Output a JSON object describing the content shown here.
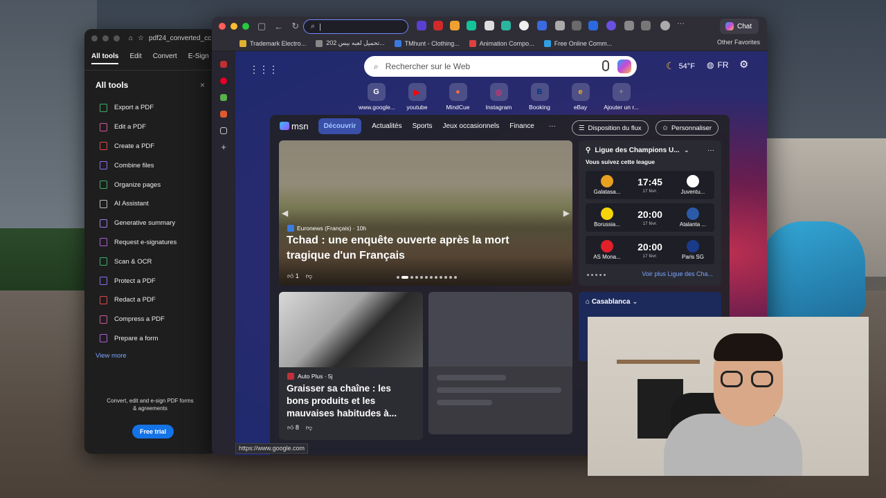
{
  "acrobat": {
    "tab_title": "pdf24_converted_cc",
    "menu": [
      "All tools",
      "Edit",
      "Convert",
      "E-Sign"
    ],
    "header": "All tools",
    "close": "×",
    "tools": [
      {
        "label": "Export a PDF",
        "color": "#3fb06b"
      },
      {
        "label": "Edit a PDF",
        "color": "#d35aa0"
      },
      {
        "label": "Create a PDF",
        "color": "#e0474c"
      },
      {
        "label": "Combine files",
        "color": "#8f6df0"
      },
      {
        "label": "Organize pages",
        "color": "#3fb06b"
      },
      {
        "label": "AI Assistant",
        "color": "#bbbbbb"
      },
      {
        "label": "Generative summary",
        "color": "#9f7df0"
      },
      {
        "label": "Request e-signatures",
        "color": "#b05fd6"
      },
      {
        "label": "Scan & OCR",
        "color": "#3fb06b"
      },
      {
        "label": "Protect a PDF",
        "color": "#8f6df0"
      },
      {
        "label": "Redact a PDF",
        "color": "#e0474c"
      },
      {
        "label": "Compress a PDF",
        "color": "#d35aa0"
      },
      {
        "label": "Prepare a form",
        "color": "#b05fd6"
      }
    ],
    "view_more": "View more",
    "footer_text": "Convert, edit and e-sign PDF forms & agreements",
    "free_trial": "Free trial"
  },
  "browser": {
    "chat_label": "Chat",
    "bookmarks": [
      "Trademark Electro...",
      "تحميل لعبه بيس 202...",
      "TMhunt - Clothing...",
      "Animation Compo...",
      "Free Online Comm..."
    ],
    "other_favorites": "Other Favorites",
    "status_url": "https://www.google.com"
  },
  "newtab": {
    "search_placeholder": "Rechercher sur le Web",
    "weather": "54°F",
    "lang": "FR",
    "quick_links": [
      {
        "label": "www.google...",
        "glyph": "G",
        "color": "#ffffff"
      },
      {
        "label": "youtube",
        "glyph": "▶",
        "color": "#ff0000"
      },
      {
        "label": "MindCue",
        "glyph": "●",
        "color": "#ff6a3d"
      },
      {
        "label": "Instagram",
        "glyph": "◎",
        "color": "#e1306c"
      },
      {
        "label": "Booking",
        "glyph": "B",
        "color": "#003580"
      },
      {
        "label": "eBay",
        "glyph": "e",
        "color": "#f5af02"
      },
      {
        "label": "Ajouter un r...",
        "glyph": "+",
        "color": "#888888"
      }
    ]
  },
  "feed": {
    "logo": "msn",
    "tabs": [
      "Découvrir",
      "Actualités",
      "Sports",
      "Jeux occasionnels",
      "Finance"
    ],
    "more": "···",
    "layout_btn": "Disposition du flux",
    "personalize_btn": "Personnaliser",
    "hero": {
      "source": "Euronews (Français) · 10h",
      "title": "Tchad : une enquête ouverte après la mort tragique d'un Français",
      "likes": "1"
    },
    "card2": {
      "source": "Auto Plus · 5j",
      "title": "Graisser sa chaîne : les bons produits et les mauvaises habitudes à...",
      "likes": "8"
    },
    "league": {
      "title": "Ligue des Champions U...",
      "subtitle": "Vous suivez cette league",
      "matches": [
        {
          "home": "Galatasa...",
          "away": "Juventu...",
          "time": "17:45",
          "date": "17 févr.",
          "home_color": "#e8a020",
          "away_color": "#ffffff"
        },
        {
          "home": "Borussia...",
          "away": "Atalanta ...",
          "time": "20:00",
          "date": "17 févr.",
          "home_color": "#f5d40a",
          "away_color": "#2a5aa8"
        },
        {
          "home": "AS Mona...",
          "away": "Paris SG",
          "time": "20:00",
          "date": "17 févr.",
          "home_color": "#e0202a",
          "away_color": "#1a3a8a"
        }
      ],
      "see_more": "Voir plus Ligue des Cha..."
    },
    "weather_city": "Casablanca"
  }
}
